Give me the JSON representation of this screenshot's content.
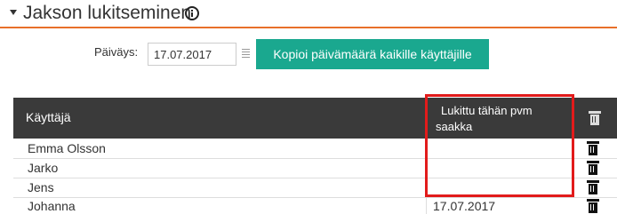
{
  "section": {
    "title": "Jakson lukitseminen",
    "collapse_icon": "caret-down-icon",
    "info_icon": "info-circle-icon"
  },
  "date_row": {
    "label": "Päiväys:",
    "value": "17.07.2017",
    "list_icon": "list-icon",
    "copy_button_label": "Kopioi päivämäärä kaikille käyttäjille"
  },
  "table": {
    "columns": {
      "user": "Käyttäjä",
      "locked_line1": "Lukittu tähän pvm",
      "locked_line2": "saakka",
      "delete_icon": "trash-icon"
    },
    "rows": [
      {
        "user": "Emma Olsson",
        "locked_until": ""
      },
      {
        "user": "Jarko",
        "locked_until": ""
      },
      {
        "user": "Jens",
        "locked_until": ""
      },
      {
        "user": "Johanna",
        "locked_until": "17.07.2017"
      }
    ]
  },
  "colors": {
    "accent_orange": "#e8702a",
    "button_teal": "#1aa88f",
    "header_dark": "#3a3a3a",
    "highlight_red": "#e21b1b"
  }
}
